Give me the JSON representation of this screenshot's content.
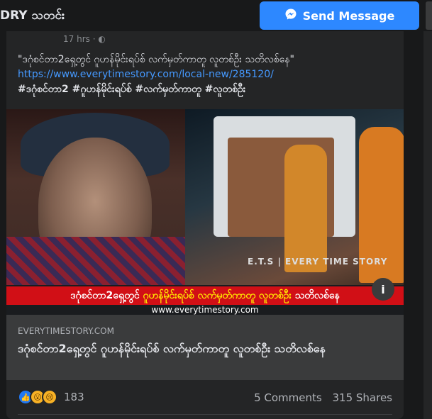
{
  "header": {
    "page_name": "DRY သတင်း",
    "send_message_label": "Send Message",
    "send_message_icon": "messenger-icon"
  },
  "post": {
    "timestamp": "17 hrs · ",
    "caption_title": "\"ဒဂုံစင်တာ2ရှေ့တွင် ဂူဟန်မိုင်းရပ်စ် လက်မှတ်ကာတူ လူတစ်ဦး သတိလစ်နေ\"",
    "caption_url": "https://www.everytimestory.com/local-new/285120/",
    "caption_hashtags": "#ဒဂုံစင်တာ2 #ဂူဟန်မိုင်းရပ်စ် #လက်မှတ်ကာတူ #လူတစ်ဦး",
    "image": {
      "banner_part1": "ဒဂုံစင်တာ2ရှေ့တွင်",
      "banner_part2": "ဂူဟန်မိုင်းရပ်စ် လက်မှတ်ကာတူ လူတစ်ဦး",
      "banner_part3": "သတိလစ်နေ",
      "watermark_top": "E.T.S | EVERY TIME STORY",
      "watermark_bottom": "www.everytimestory.com",
      "info_label": "i"
    },
    "link_preview": {
      "domain": "EVERYTIMESTORY.COM",
      "title": "ဒဂုံစင်တာ2ရှေ့တွင် ဂူဟန်မိုင်းရပ်စ် လက်မှတ်ကာတူ လူတစ်ဦး သတိလစ်နေ"
    },
    "reactions": {
      "icons": [
        "like-icon",
        "wow-icon",
        "sad-icon"
      ],
      "count": "183"
    },
    "comments": "5 Comments",
    "shares": "315 Shares"
  },
  "colors": {
    "background": "#18191a",
    "card": "#242526",
    "accent": "#2d88ff",
    "link": "#4599ff",
    "banner_red": "#d10f16",
    "banner_yellow": "#ffe600"
  }
}
